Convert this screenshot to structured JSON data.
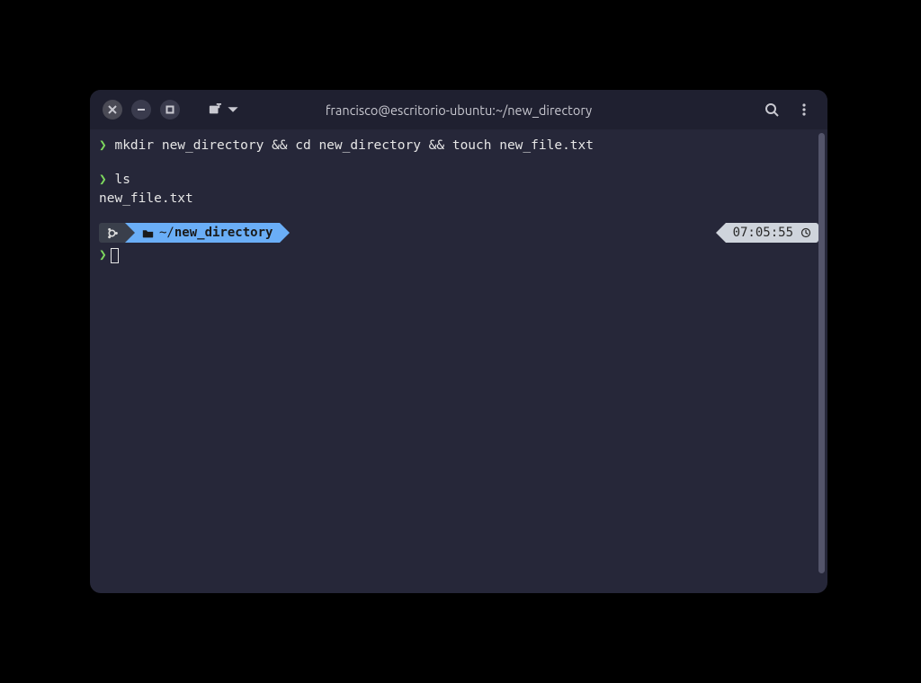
{
  "titlebar": {
    "title": "francisco@escritorio-ubuntu:~/new_directory"
  },
  "terminal": {
    "prompt_symbol": "❯",
    "lines": {
      "cmd1": "mkdir new_directory && cd new_directory && touch new_file.txt",
      "cmd2": "ls",
      "out1": "new_file.txt"
    },
    "powerline": {
      "cwd_prefix": "~/",
      "cwd_name": "new_directory",
      "time": "07:05:55"
    }
  },
  "colors": {
    "window_bg": "#262739",
    "titlebar_bg": "#1f2030",
    "prompt_green": "#7dd95e",
    "pill_blue": "#6aaef7",
    "pill_grey": "#cfd4dc"
  },
  "icons": {
    "close": "close-icon",
    "minimize": "minimize-icon",
    "maximize": "maximize-icon",
    "new_tab": "new-tab-icon",
    "dropdown": "chevron-down-icon",
    "search": "search-icon",
    "menu": "kebab-menu-icon",
    "ubuntu": "ubuntu-icon",
    "folder": "folder-open-icon",
    "clock": "clock-icon"
  }
}
